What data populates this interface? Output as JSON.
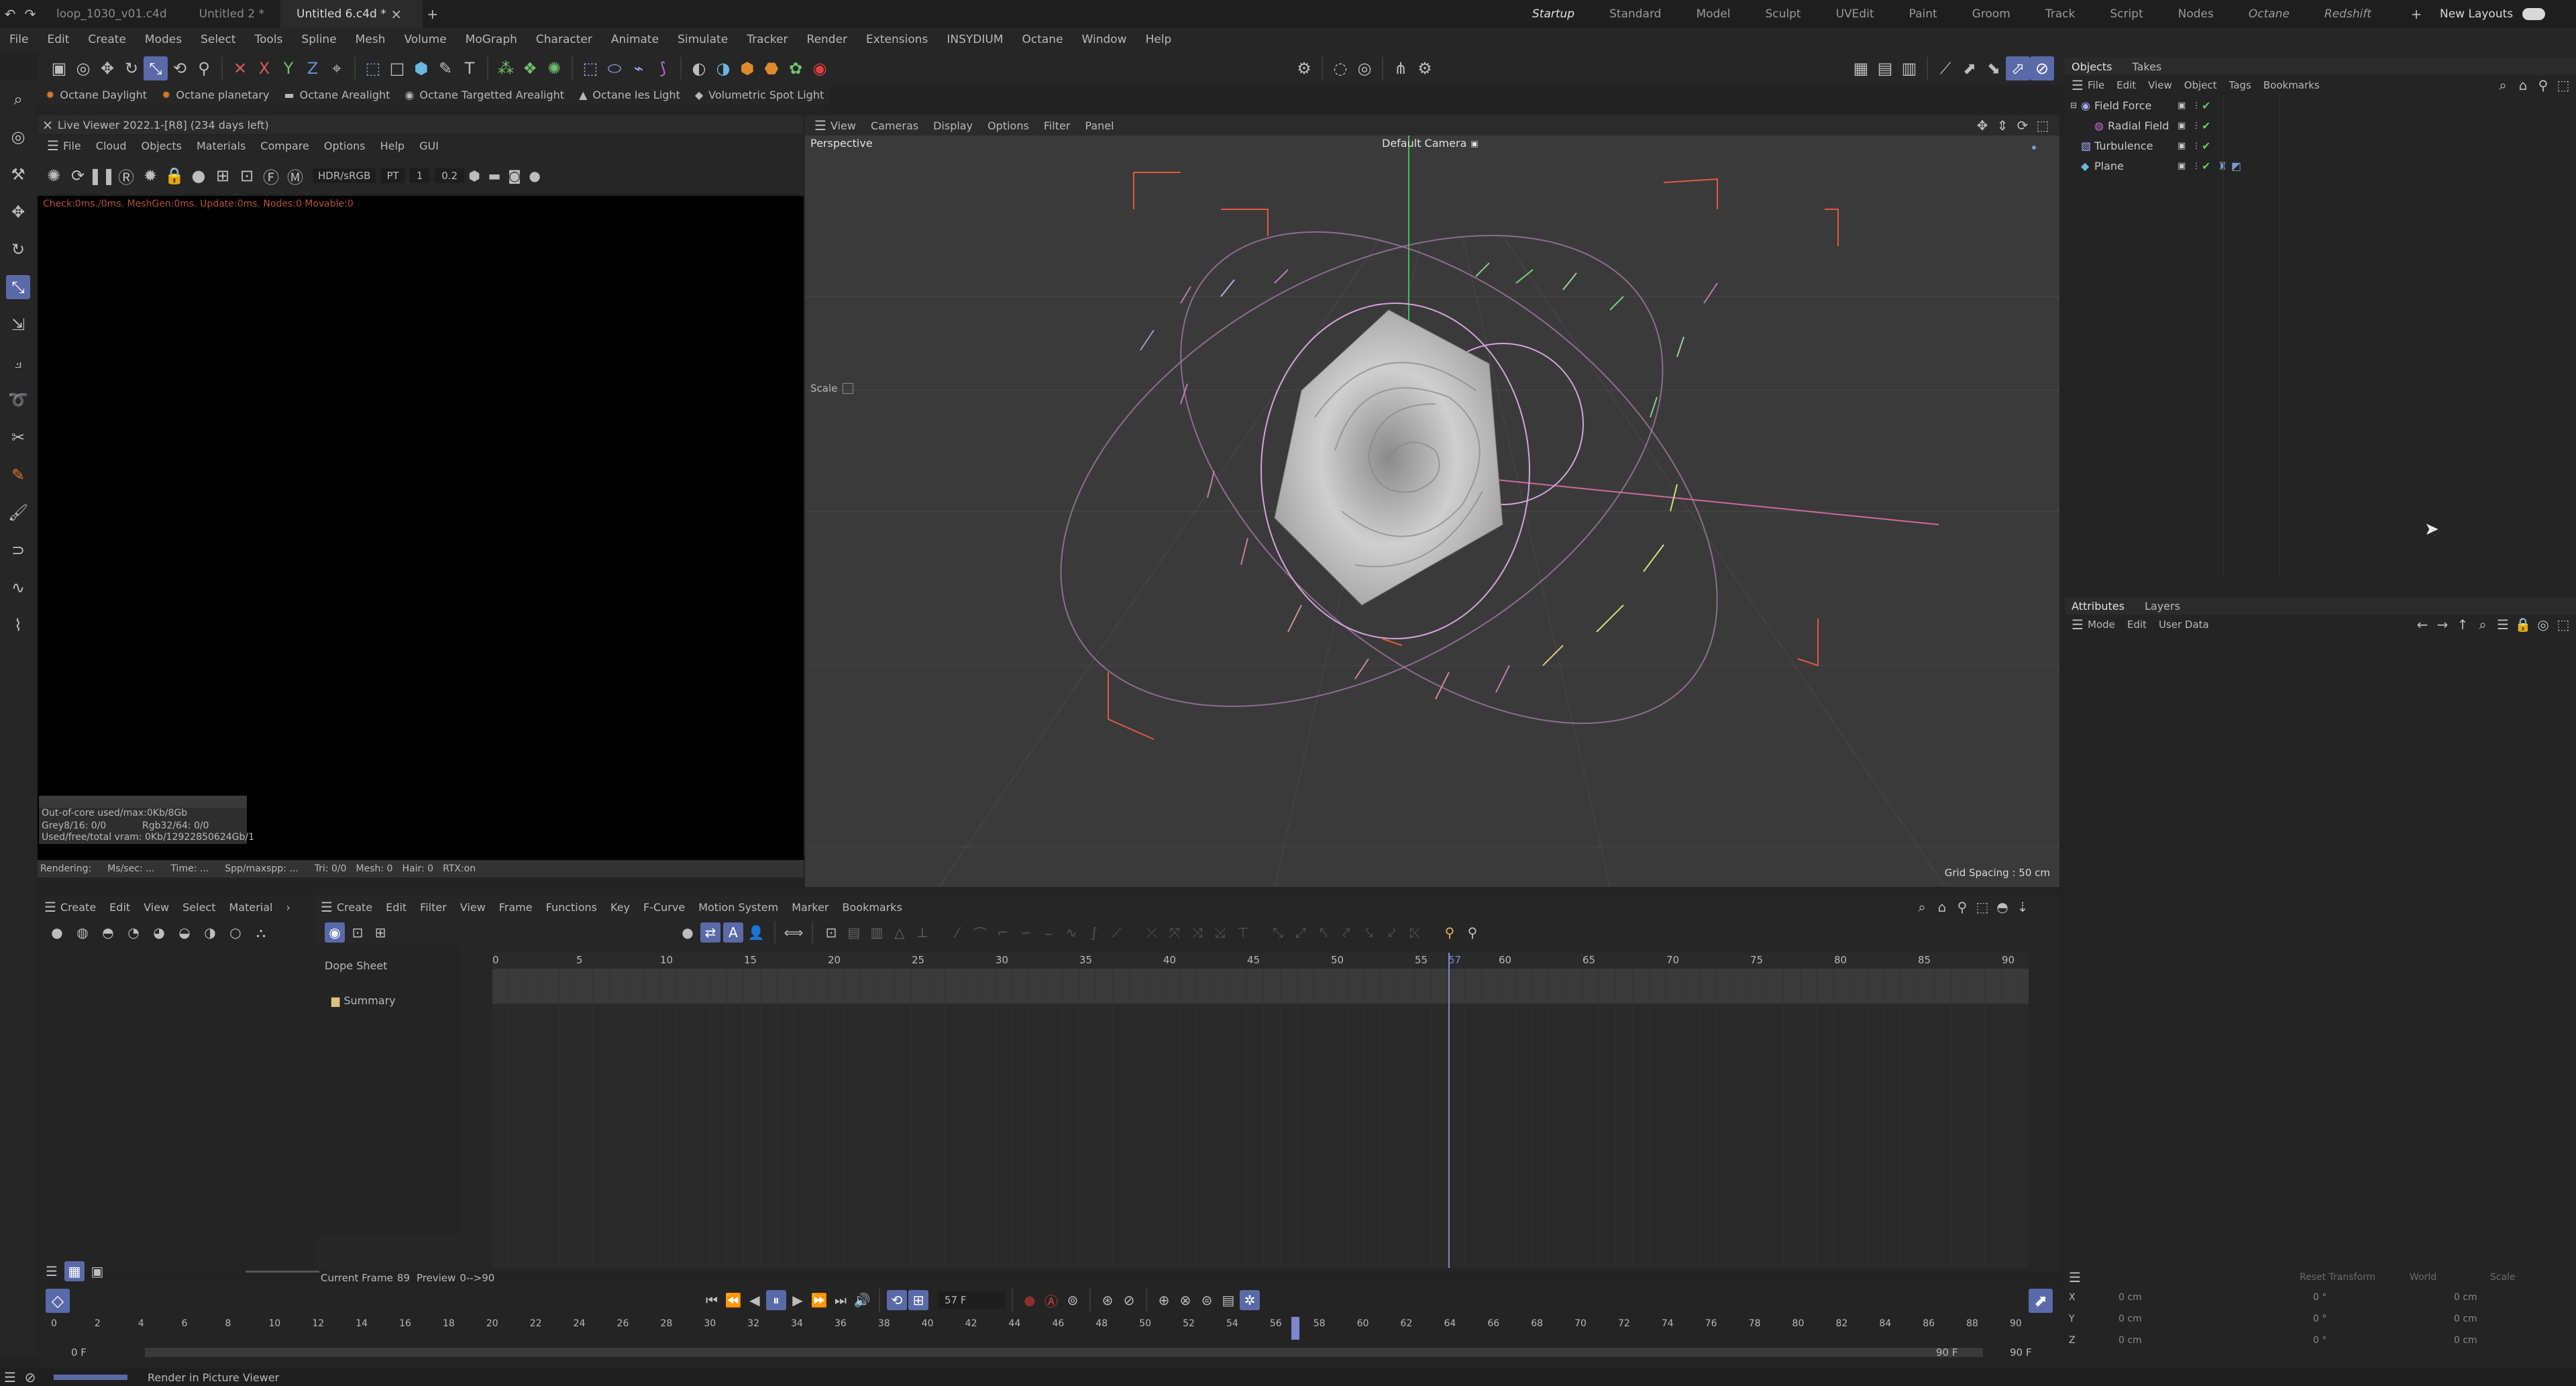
{
  "titlebar": {
    "tabs": [
      "loop_1030_v01.c4d",
      "Untitled 2 *",
      "Untitled 6.c4d *"
    ],
    "active_tab": "Untitled 6.c4d *",
    "add_tab": "+",
    "layouts": [
      "Startup",
      "Standard",
      "Model",
      "Sculpt",
      "UVEdit",
      "Paint",
      "Groom",
      "Track",
      "Script",
      "Nodes",
      "Octane",
      "Redshift"
    ],
    "active_layout": "Startup",
    "new_layouts": "New Layouts"
  },
  "menubar": {
    "items": [
      "File",
      "Edit",
      "Create",
      "Modes",
      "Select",
      "Tools",
      "Spline",
      "Mesh",
      "Volume",
      "MoGraph",
      "Character",
      "Animate",
      "Simulate",
      "Tracker",
      "Render",
      "Extensions",
      "INSYDIUM",
      "Octane",
      "Window",
      "Help"
    ]
  },
  "toolbar2": {
    "items": [
      "Octane Daylight",
      "Octane planetary",
      "Octane Arealight",
      "Octane Targetted Arealight",
      "Octane Ies Light",
      "Volumetric Spot Light"
    ]
  },
  "liveviewer": {
    "title": "Live Viewer 2022.1-[R8] (234 days left)",
    "menu": [
      "File",
      "Cloud",
      "Objects",
      "Materials",
      "Compare",
      "Options",
      "Help",
      "GUI"
    ],
    "colorspace": "HDR/sRGB",
    "kernel": "PT",
    "val1": "1",
    "val2": "0.2",
    "status": "Check:0ms./0ms. MeshGen:0ms. Update:0ms. Nodes:0 Movable:0",
    "stats": {
      "outofcore": "Out-of-core used/max:0Kb/8Gb",
      "grey": "Grey8/16: 0/0",
      "rgb": "Rgb32/64: 0/0",
      "vram": "Used/free/total vram: 0Kb/12922850624Gb/1",
      "rendering": "Rendering:",
      "ms": "Ms/sec: ...",
      "time": "Time: ...",
      "spp": "Spp/maxspp: ...",
      "tri": "Tri: 0/0",
      "mesh": "Mesh: 0",
      "hair": "Hair: 0",
      "rtx": "RTX:on"
    }
  },
  "viewport": {
    "menu": [
      "View",
      "Cameras",
      "Display",
      "Options",
      "Filter",
      "Panel"
    ],
    "mode": "Perspective",
    "camera": "Default Camera",
    "scale_label": "Scale",
    "grid_spacing": "Grid Spacing : 50 cm"
  },
  "objects": {
    "tabs": [
      "Objects",
      "Takes"
    ],
    "menu": [
      "File",
      "Edit",
      "View",
      "Object",
      "Tags",
      "Bookmarks"
    ],
    "items": [
      {
        "name": "Field Force",
        "indent": 0
      },
      {
        "name": "Radial Field",
        "indent": 1
      },
      {
        "name": "Turbulence",
        "indent": 0
      },
      {
        "name": "Plane",
        "indent": 0
      }
    ]
  },
  "attributes": {
    "tabs": [
      "Attributes",
      "Layers"
    ],
    "menu": [
      "Mode",
      "Edit",
      "User Data"
    ]
  },
  "coords": {
    "reset": "Reset Transform",
    "world": "World",
    "scale": "Scale",
    "rows": [
      {
        "axis": "X",
        "pos": "0 cm",
        "rot": "0 °",
        "size": "0 cm"
      },
      {
        "axis": "Y",
        "pos": "0 cm",
        "rot": "0 °",
        "size": "0 cm"
      },
      {
        "axis": "Z",
        "pos": "0 cm",
        "rot": "0 °",
        "size": "0 cm"
      }
    ]
  },
  "material": {
    "menu": [
      "Create",
      "Edit",
      "View",
      "Select",
      "Material"
    ]
  },
  "timeline": {
    "menu": [
      "Create",
      "Edit",
      "Filter",
      "View",
      "Frame",
      "Functions",
      "Key",
      "F-Curve",
      "Motion System",
      "Marker",
      "Bookmarks"
    ],
    "dope_sheet": "Dope Sheet",
    "summary": "Summary",
    "ruler": [
      "0",
      "5",
      "10",
      "15",
      "20",
      "25",
      "30",
      "35",
      "40",
      "45",
      "50",
      "55",
      "57",
      "60",
      "65",
      "70",
      "75",
      "80",
      "85",
      "90"
    ],
    "current_frame_label": "Current Frame",
    "current_frame": "89",
    "preview_label": "Preview",
    "preview": "0-->90",
    "playhead_frame": 57
  },
  "transport": {
    "frame_field": "57 F",
    "ruler": [
      "0",
      "2",
      "4",
      "6",
      "8",
      "10",
      "12",
      "14",
      "16",
      "18",
      "20",
      "22",
      "24",
      "26",
      "28",
      "30",
      "32",
      "34",
      "36",
      "38",
      "40",
      "42",
      "44",
      "46",
      "48",
      "50",
      "52",
      "54",
      "56",
      "58",
      "60",
      "62",
      "64",
      "66",
      "68",
      "70",
      "72",
      "74",
      "76",
      "78",
      "80",
      "82",
      "84",
      "86",
      "88",
      "90"
    ],
    "start": "0 F",
    "start2": "0 F",
    "end": "90 F",
    "end2": "90 F"
  },
  "statusbar": {
    "text": "Render in Picture Viewer"
  }
}
